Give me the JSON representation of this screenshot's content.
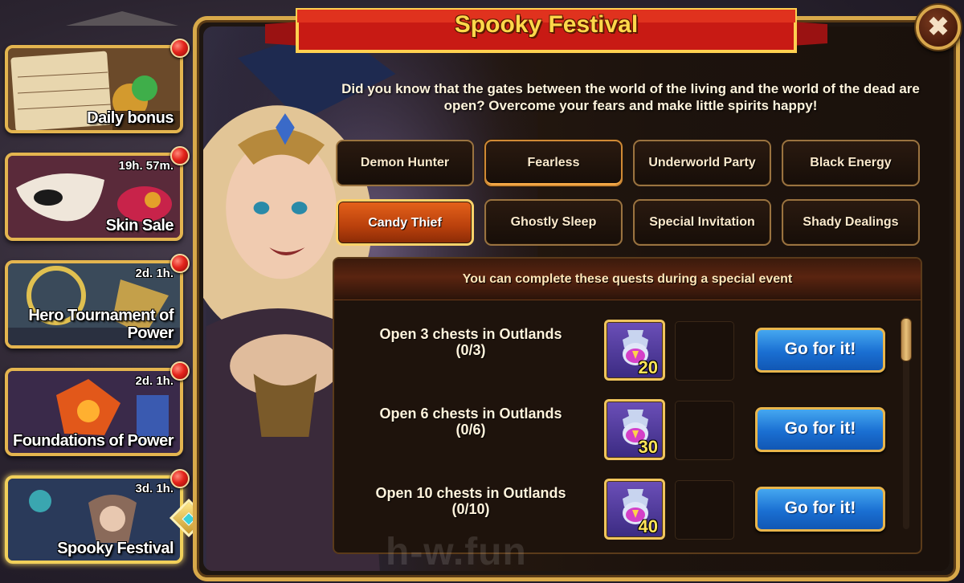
{
  "event_list": [
    {
      "label": "Daily bonus",
      "timer": "",
      "notification": true
    },
    {
      "label": "Skin Sale",
      "timer": "19h. 57m.",
      "notification": true
    },
    {
      "label": "Hero Tournament of Power",
      "timer": "2d. 1h.",
      "notification": true
    },
    {
      "label": "Foundations of Power",
      "timer": "2d. 1h.",
      "notification": true
    },
    {
      "label": "Spooky Festival",
      "timer": "3d. 1h.",
      "notification": true,
      "active": true
    }
  ],
  "panel": {
    "title": "Spooky Festival",
    "close_icon": "✖",
    "intro": "Did you know that the gates between the world of the living and the world of the dead are open? Overcome your fears and make little spirits happy!",
    "tabs": [
      {
        "label": "Demon Hunter"
      },
      {
        "label": "Fearless"
      },
      {
        "label": "Underworld Party"
      },
      {
        "label": "Black Energy"
      },
      {
        "label": "Candy Thief",
        "active": true
      },
      {
        "label": "Ghostly Sleep"
      },
      {
        "label": "Special Invitation"
      },
      {
        "label": "Shady Dealings"
      }
    ],
    "quest_header": "You can complete these quests during a special event",
    "quests": [
      {
        "title": "Open 3 chests in Outlands",
        "progress": "(0/3)",
        "reward_icon": "potion-icon",
        "reward_qty": "20",
        "button": "Go for it!"
      },
      {
        "title": "Open 6 chests in Outlands",
        "progress": "(0/6)",
        "reward_icon": "potion-icon",
        "reward_qty": "30",
        "button": "Go for it!"
      },
      {
        "title": "Open 10 chests in Outlands",
        "progress": "(0/10)",
        "reward_icon": "potion-icon",
        "reward_qty": "40",
        "button": "Go for it!"
      }
    ]
  },
  "watermark": "h-w.fun",
  "colors": {
    "accent_gold": "#e4b54f",
    "active_tab": "#d0541a",
    "go_button": "#1a6fd2",
    "title": "#ffd84a"
  }
}
